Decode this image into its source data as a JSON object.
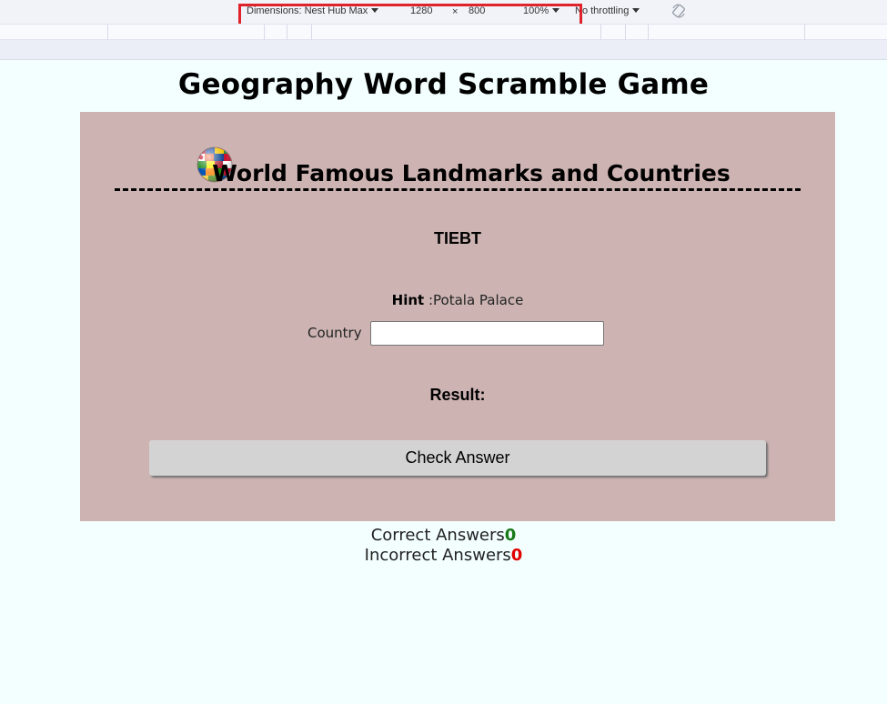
{
  "devtools": {
    "dimensions_label": "Dimensions: Nest Hub Max",
    "width": "1280",
    "times": "×",
    "height": "800",
    "zoom": "100%",
    "throttling": "No throttling",
    "rotate_icon": "rotate-icon",
    "highlight_color": "#e0232a"
  },
  "page": {
    "title": "Geography Word Scramble Game",
    "background": "#f2fffe"
  },
  "card": {
    "background": "#cdb4b3",
    "heading": "World Famous Landmarks and Countries",
    "globe_icon": "globe-icon",
    "scrambled_word": "TIEBT",
    "hint_label": "Hint",
    "hint_text": ":Potala Palace",
    "country_label": "Country",
    "country_value": "",
    "result_label": "Result:",
    "check_button": "Check Answer"
  },
  "score": {
    "correct_label": "Correct Answers",
    "correct_value": "0",
    "correct_color": "#1a7a1a",
    "incorrect_label": "Incorrect Answers",
    "incorrect_value": "0",
    "incorrect_color": "#e00000"
  }
}
